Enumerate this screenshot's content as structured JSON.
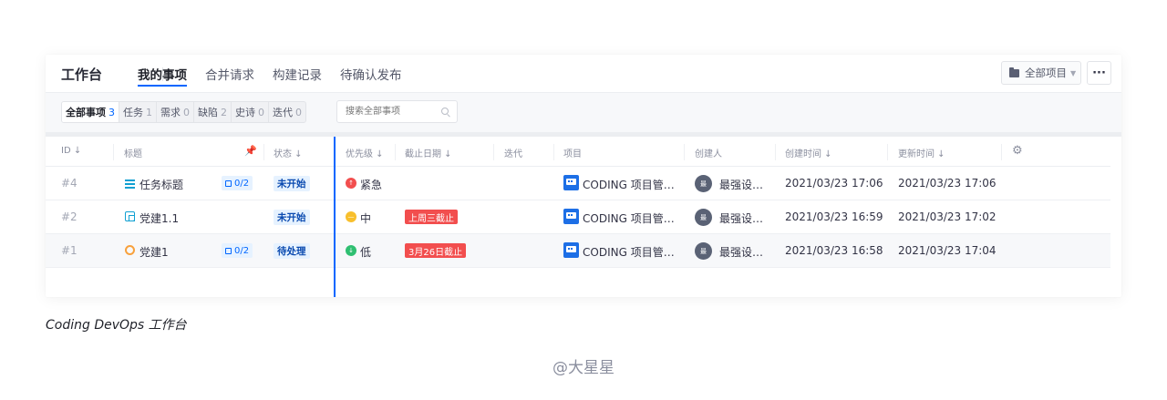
{
  "header": {
    "brand": "工作台",
    "tabs": [
      {
        "label": "我的事项",
        "active": true
      },
      {
        "label": "合并请求"
      },
      {
        "label": "构建记录"
      },
      {
        "label": "待确认发布"
      }
    ],
    "project_selector": "全部项目",
    "more_label": "···"
  },
  "filters": {
    "segments": [
      {
        "label": "全部事项",
        "count": "3",
        "active": true
      },
      {
        "label": "任务",
        "count": "1"
      },
      {
        "label": "需求",
        "count": "0"
      },
      {
        "label": "缺陷",
        "count": "2"
      },
      {
        "label": "史诗",
        "count": "0"
      },
      {
        "label": "迭代",
        "count": "0"
      }
    ],
    "search_placeholder": "搜索全部事项"
  },
  "table": {
    "columns": {
      "id": "ID ↓",
      "title": "标题",
      "status": "状态 ↓",
      "priority": "优先级 ↓",
      "due": "截止日期 ↓",
      "iteration": "迭代",
      "project": "项目",
      "creator": "创建人",
      "created": "创建时间 ↓",
      "updated": "更新时间 ↓"
    },
    "rows": [
      {
        "id": "#4",
        "type": "task",
        "title": "任务标题",
        "subtask": "0/2",
        "status": "未开始",
        "priority": "紧急",
        "priority_icon": "↑",
        "priority_color": "#f24e4e",
        "due": "",
        "project": "CODING 项目管…",
        "avatar": "最",
        "creator": "最强设…",
        "created": "2021/03/23 17:06",
        "updated": "2021/03/23 17:06"
      },
      {
        "id": "#2",
        "type": "requirement",
        "title": "党建1.1",
        "subtask": "",
        "status": "未开始",
        "priority": "中",
        "priority_icon": "—",
        "priority_color": "#f8bf2c",
        "due": "上周三截止",
        "project": "CODING 项目管…",
        "avatar": "最",
        "creator": "最强设…",
        "created": "2021/03/23 16:59",
        "updated": "2021/03/23 17:02"
      },
      {
        "id": "#1",
        "type": "bug",
        "title": "党建1",
        "subtask": "0/2",
        "status": "待处理",
        "priority": "低",
        "priority_icon": "↓",
        "priority_color": "#2fbf71",
        "due": "3月26日截止",
        "project": "CODING 项目管…",
        "avatar": "最",
        "creator": "最强设…",
        "created": "2021/03/23 16:58",
        "updated": "2021/03/23 17:04"
      }
    ]
  },
  "caption": "Coding DevOps 工作台",
  "watermark": "@大星星",
  "colors": {
    "accent": "#0066ff",
    "danger": "#f24e4e"
  }
}
